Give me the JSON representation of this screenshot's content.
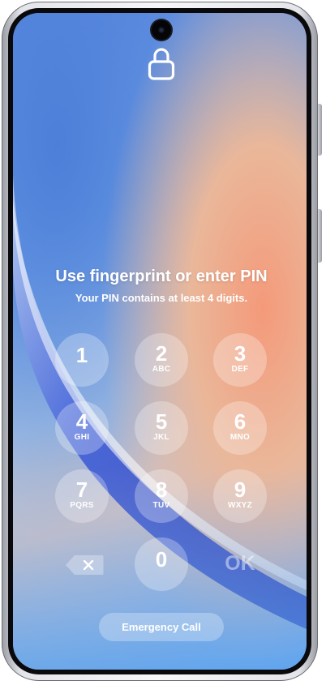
{
  "lock_screen": {
    "title": "Use fingerprint or enter PIN",
    "subtitle": "Your PIN contains at least 4 digits."
  },
  "keypad": {
    "keys": [
      {
        "digit": "1",
        "letters": ""
      },
      {
        "digit": "2",
        "letters": "ABC"
      },
      {
        "digit": "3",
        "letters": "DEF"
      },
      {
        "digit": "4",
        "letters": "GHI"
      },
      {
        "digit": "5",
        "letters": "JKL"
      },
      {
        "digit": "6",
        "letters": "MNO"
      },
      {
        "digit": "7",
        "letters": "PQRS"
      },
      {
        "digit": "8",
        "letters": "TUV"
      },
      {
        "digit": "9",
        "letters": "WXYZ"
      },
      {
        "digit": "0",
        "letters": ""
      }
    ],
    "ok_label": "OK",
    "backspace_icon": "backspace-icon"
  },
  "emergency_call_label": "Emergency Call",
  "icons": {
    "lock": "lock-icon",
    "camera": "front-camera"
  }
}
